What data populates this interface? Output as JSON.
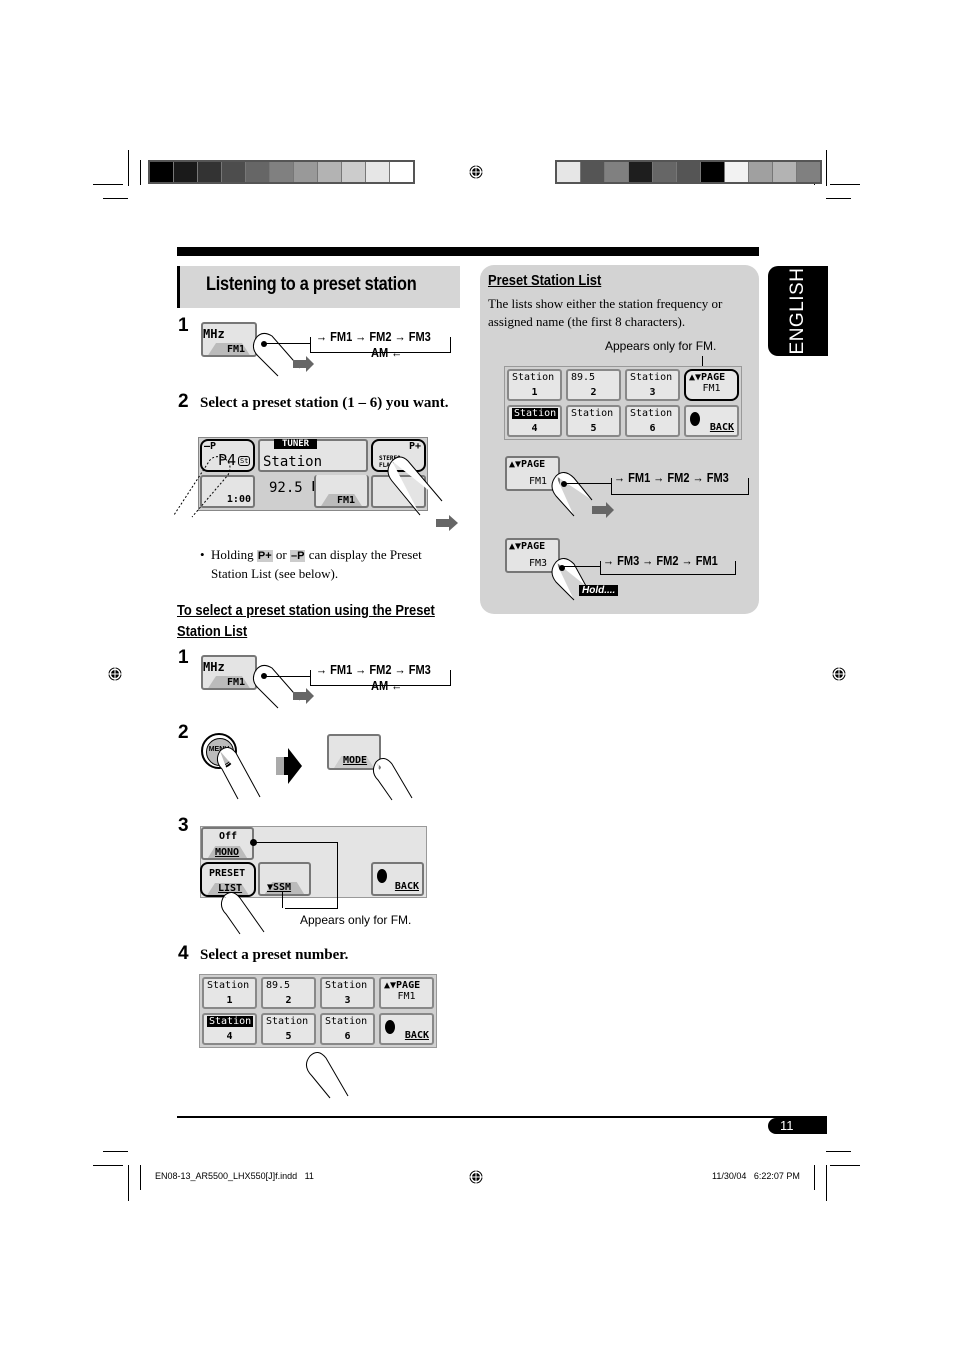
{
  "print_marks": {
    "left_swatches": [
      "#000000",
      "#1a1a1a",
      "#333333",
      "#4d4d4d",
      "#666666",
      "#808080",
      "#999999",
      "#b3b3b3",
      "#cccccc",
      "#e6e6e6",
      "#ffffff"
    ],
    "right_swatches": [
      "#e6e6e6",
      "#555555",
      "#808080",
      "#1e1e1e",
      "#666666",
      "#555555",
      "#000000",
      "#f2f2f2",
      "#a0a0a0",
      "#b3b3b3",
      "#808080"
    ]
  },
  "section": {
    "title": "Listening to a preset station",
    "language_tab": "ENGLISH"
  },
  "steps": [
    {
      "num": "1",
      "button_top": "MHz",
      "button_bottom": "FM1",
      "flow": [
        "FM1",
        "FM2",
        "FM3"
      ],
      "flow_return": "AM"
    },
    {
      "num": "2",
      "text": "Select a preset station (1 – 6) you want.",
      "display": {
        "left_top": "–P",
        "left_main": "P4",
        "left_badge": "St",
        "mode": "TUNER",
        "station": "Station",
        "freq": "92.5",
        "unit": "MHz",
        "band": "FM1",
        "clock": "1:00",
        "right_top": "P+",
        "right_l1": "STEREO",
        "right_l2": "FLAT"
      }
    },
    {
      "bullet": "Holding",
      "bullet_icon1": "P+",
      "bullet_or": "or",
      "bullet_icon2": "–P",
      "bullet_rest": "can display the Preset Station List (see below)."
    }
  ],
  "subsection": {
    "title": "To select a preset station using the Preset Station List",
    "step1": {
      "num": "1",
      "button_top": "MHz",
      "button_bottom": "FM1",
      "flow": [
        "FM1",
        "FM2",
        "FM3"
      ],
      "flow_return": "AM"
    },
    "step2": {
      "num": "2",
      "menu_label": "MENU",
      "mode_label": "MODE"
    },
    "step3": {
      "num": "3",
      "off_label": "Off",
      "mono_label": "MONO",
      "preset_l1": "PRESET",
      "preset_l2": "LIST",
      "ssm_label": "▼SSM",
      "back_label": "BACK",
      "note": "Appears only for FM."
    },
    "step4": {
      "num": "4",
      "text": "Select a preset number."
    }
  },
  "preset_grid": {
    "cells": [
      {
        "title": "Station",
        "num": "1"
      },
      {
        "title": "89.5",
        "num": "2"
      },
      {
        "title": "Station",
        "num": "3"
      },
      {
        "title": "▲▼PAGE",
        "num": "FM1"
      },
      {
        "title": "Station",
        "num": "4"
      },
      {
        "title": "Station",
        "num": "5"
      },
      {
        "title": "Station",
        "num": "6"
      },
      {
        "title": "BACK",
        "num": ""
      }
    ]
  },
  "side_panel": {
    "title": "Preset Station List",
    "desc": "The lists show either the station frequency or assigned name (the first 8 characters).",
    "note": "Appears only for FM.",
    "page_btn_label": "▲▼PAGE",
    "press_band": "FM1",
    "press_flow": [
      "FM1",
      "FM2",
      "FM3"
    ],
    "hold_band": "FM3",
    "hold_flow": [
      "FM3",
      "FM2",
      "FM1"
    ],
    "hold_label": "Hold...."
  },
  "footer": {
    "page_number": "11",
    "file_name": "EN08-13_AR5500_LHX550[J]f.indd   11",
    "timestamp": "11/30/04   6:22:07 PM"
  }
}
